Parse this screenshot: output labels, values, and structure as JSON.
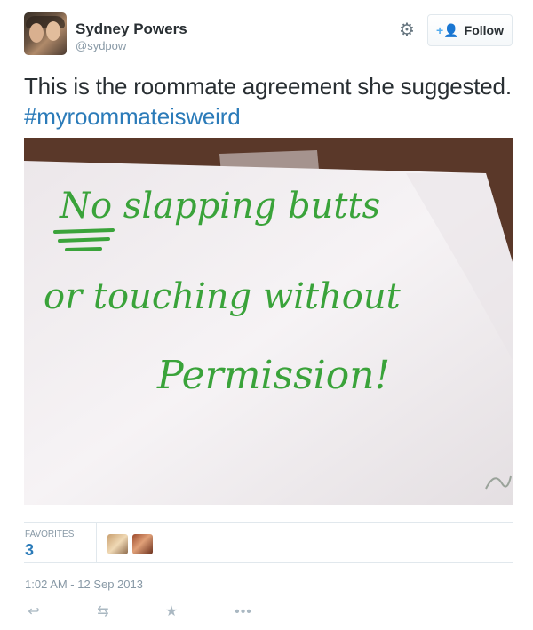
{
  "user": {
    "name": "Sydney Powers",
    "handle": "@sydpow"
  },
  "header": {
    "settings_icon": "gear-icon",
    "follow_icon": "add-user-icon",
    "follow_label": "Follow"
  },
  "tweet": {
    "text": "This is the roommate agreement she suggested.",
    "hashtag": "#myroommateisweird"
  },
  "photo": {
    "handwritten_line1": "No slapping butts",
    "handwritten_line2": "or touching without",
    "handwritten_line3": "Permission!",
    "ink_color": "#3aa33a",
    "paper_color": "#f2eef0"
  },
  "stats": {
    "favorites_label": "FAVORITES",
    "favorites_count": "3"
  },
  "timestamp": "1:02 AM - 12 Sep 2013",
  "actions": {
    "reply_icon": "reply-icon",
    "retweet_icon": "retweet-icon",
    "favorite_icon": "star-icon",
    "more_icon": "more-icon",
    "more_glyph": "•••"
  },
  "colors": {
    "link": "#2b7bb9",
    "muted": "#8899a6",
    "text": "#292f33"
  }
}
